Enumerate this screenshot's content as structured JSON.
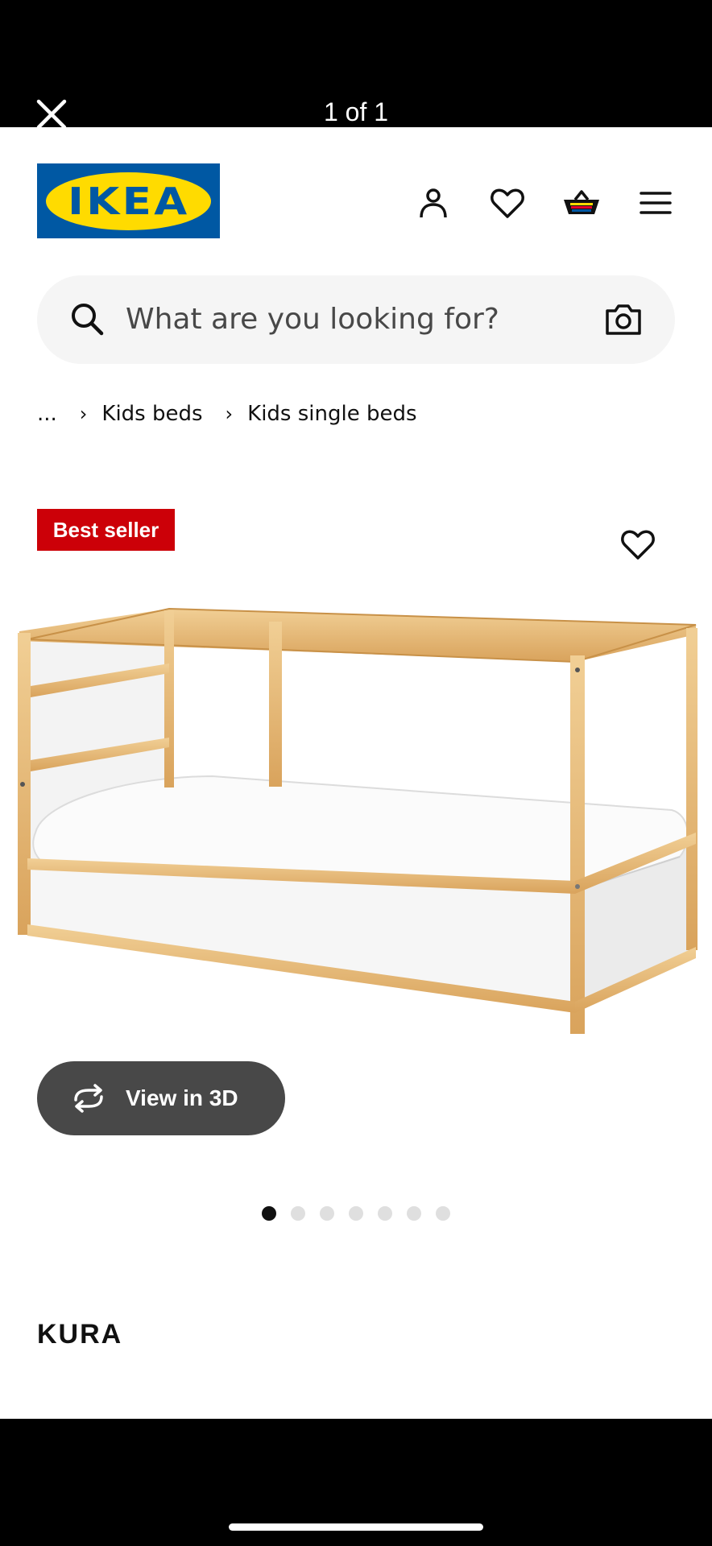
{
  "viewer": {
    "counter": "1 of 1"
  },
  "header": {
    "logo_text": "IKEA",
    "icons": [
      "person-icon",
      "heart-icon",
      "basket-icon",
      "hamburger-menu-icon"
    ]
  },
  "search": {
    "placeholder": "What are you looking for?"
  },
  "breadcrumb": {
    "items": [
      "...",
      "Kids beds",
      "Kids single beds"
    ]
  },
  "product": {
    "badge": "Best seller",
    "view3d_label": "View in 3D",
    "image_count": 7,
    "active_image": 1,
    "name_partial": "KURA"
  },
  "colors": {
    "brand_blue": "#0058a3",
    "brand_yellow": "#ffdb00",
    "badge_red": "#cc0008",
    "button_gray": "#484848"
  },
  "system_nav": {
    "icons": [
      "recent-apps-icon",
      "home-icon",
      "back-icon",
      "accessibility-icon"
    ]
  }
}
